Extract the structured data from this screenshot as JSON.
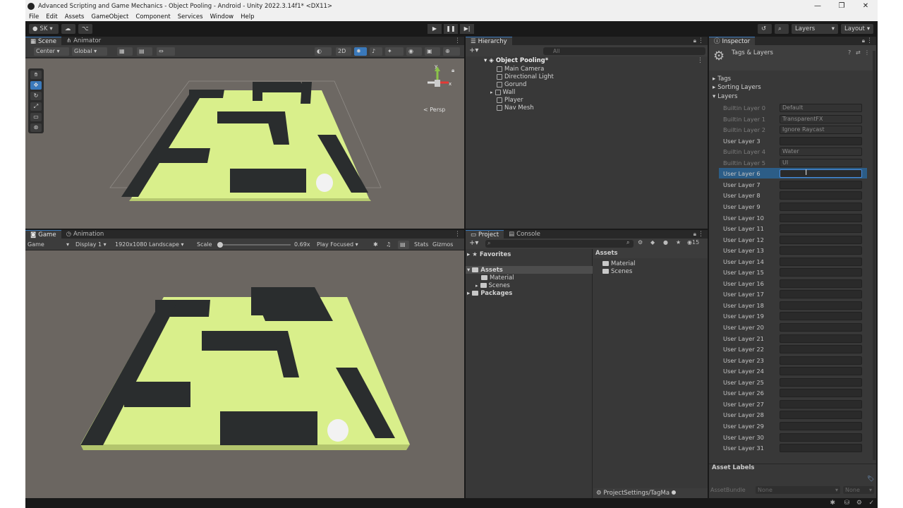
{
  "window": {
    "title": "Advanced Scripting and Game Mechanics - Object Pooling - Android - Unity 2022.3.14f1* <DX11>",
    "minimize": "—",
    "maximize": "❐",
    "close": "✕"
  },
  "menu": [
    "File",
    "Edit",
    "Assets",
    "GameObject",
    "Component",
    "Services",
    "Window",
    "Help"
  ],
  "toolbar": {
    "account": "SK",
    "layers": "Layers",
    "layout": "Layout"
  },
  "scene": {
    "tabs": [
      "Scene",
      "Animator"
    ],
    "pivot": "Center",
    "space": "Global",
    "mode2d": "2D",
    "persp": "< Persp"
  },
  "game": {
    "tabs": [
      "Game",
      "Animation"
    ],
    "mode": "Game",
    "display": "Display 1",
    "resolution": "1920x1080 Landscape",
    "scale_label": "Scale",
    "scale_value": "0.69x",
    "play_focus": "Play Focused",
    "stats": "Stats",
    "gizmos": "Gizmos"
  },
  "hierarchy": {
    "tab": "Hierarchy",
    "search_placeholder": "All",
    "scene_name": "Object Pooling*",
    "items": [
      "Main Camera",
      "Directional Light",
      "Gorund",
      "Wall",
      "Player",
      "Nav Mesh"
    ]
  },
  "project": {
    "tabs": [
      "Project",
      "Console"
    ],
    "favorites": "Favorites",
    "assets": "Assets",
    "asset_folders": [
      "Material",
      "Scenes"
    ],
    "packages": "Packages",
    "right_header": "Assets",
    "right_items": [
      "Material",
      "Scenes"
    ],
    "count": "15",
    "footer_path": "ProjectSettings/TagMa"
  },
  "inspector": {
    "tab": "Inspector",
    "title": "Tags & Layers",
    "sections": [
      "Tags",
      "Sorting Layers",
      "Layers"
    ],
    "layers": [
      {
        "name": "Builtin Layer 0",
        "value": "Default",
        "builtin": true
      },
      {
        "name": "Builtin Layer 1",
        "value": "TransparentFX",
        "builtin": true
      },
      {
        "name": "Builtin Layer 2",
        "value": "Ignore Raycast",
        "builtin": true
      },
      {
        "name": "User Layer 3",
        "value": "",
        "builtin": false
      },
      {
        "name": "Builtin Layer 4",
        "value": "Water",
        "builtin": true
      },
      {
        "name": "Builtin Layer 5",
        "value": "UI",
        "builtin": true
      },
      {
        "name": "User Layer 6",
        "value": "",
        "builtin": false,
        "active": true
      },
      {
        "name": "User Layer 7",
        "value": "",
        "builtin": false
      },
      {
        "name": "User Layer 8",
        "value": "",
        "builtin": false
      },
      {
        "name": "User Layer 9",
        "value": "",
        "builtin": false
      },
      {
        "name": "User Layer 10",
        "value": "",
        "builtin": false
      },
      {
        "name": "User Layer 11",
        "value": "",
        "builtin": false
      },
      {
        "name": "User Layer 12",
        "value": "",
        "builtin": false
      },
      {
        "name": "User Layer 13",
        "value": "",
        "builtin": false
      },
      {
        "name": "User Layer 14",
        "value": "",
        "builtin": false
      },
      {
        "name": "User Layer 15",
        "value": "",
        "builtin": false
      },
      {
        "name": "User Layer 16",
        "value": "",
        "builtin": false
      },
      {
        "name": "User Layer 17",
        "value": "",
        "builtin": false
      },
      {
        "name": "User Layer 18",
        "value": "",
        "builtin": false
      },
      {
        "name": "User Layer 19",
        "value": "",
        "builtin": false
      },
      {
        "name": "User Layer 20",
        "value": "",
        "builtin": false
      },
      {
        "name": "User Layer 21",
        "value": "",
        "builtin": false
      },
      {
        "name": "User Layer 22",
        "value": "",
        "builtin": false
      },
      {
        "name": "User Layer 23",
        "value": "",
        "builtin": false
      },
      {
        "name": "User Layer 24",
        "value": "",
        "builtin": false
      },
      {
        "name": "User Layer 25",
        "value": "",
        "builtin": false
      },
      {
        "name": "User Layer 26",
        "value": "",
        "builtin": false
      },
      {
        "name": "User Layer 27",
        "value": "",
        "builtin": false
      },
      {
        "name": "User Layer 28",
        "value": "",
        "builtin": false
      },
      {
        "name": "User Layer 29",
        "value": "",
        "builtin": false
      },
      {
        "name": "User Layer 30",
        "value": "",
        "builtin": false
      },
      {
        "name": "User Layer 31",
        "value": "",
        "builtin": false
      }
    ],
    "asset_labels": "Asset Labels",
    "asset_bundle": "AssetBundle",
    "bundle_none": "None",
    "variant_none": "None"
  },
  "colors": {
    "accent": "#3a79bb",
    "floor": "#d9ef8b",
    "wall": "#2a2d2e",
    "viewport_bg": "#6a6560"
  }
}
